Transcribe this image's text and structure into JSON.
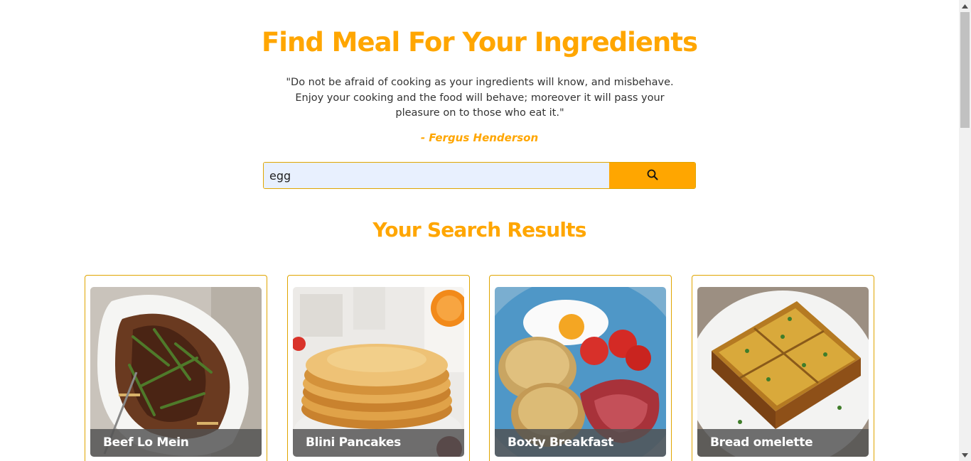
{
  "header": {
    "title": "Find Meal For Your Ingredients",
    "quote": "\"Do not be afraid of cooking as your ingredients will know, and misbehave. Enjoy your cooking and the food will behave; moreover it will pass your pleasure on to those who eat it.\"",
    "author": "- Fergus Henderson"
  },
  "search": {
    "value": "egg",
    "button_icon": "search-icon"
  },
  "results": {
    "title": "Your Search Results",
    "meals": [
      {
        "name": "Beef Lo Mein"
      },
      {
        "name": "Blini Pancakes"
      },
      {
        "name": "Boxty Breakfast"
      },
      {
        "name": "Bread omelette"
      }
    ]
  },
  "colors": {
    "accent": "#ffa600",
    "input_bg": "#e8f0fe"
  }
}
